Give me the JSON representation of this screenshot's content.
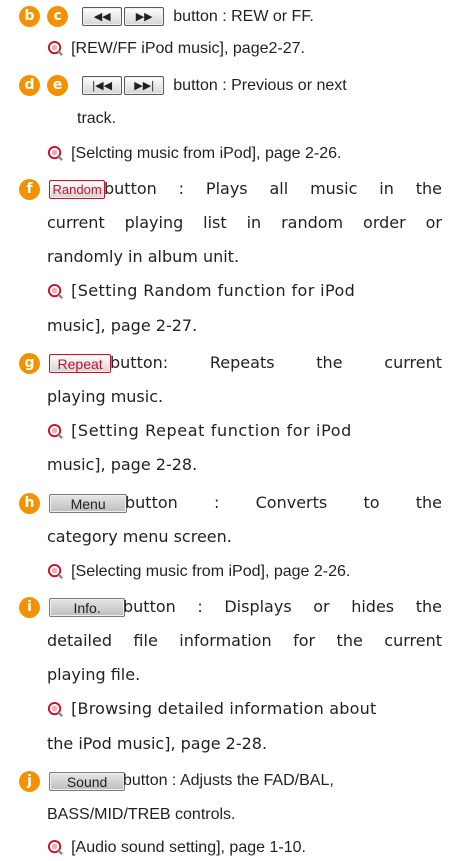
{
  "items": [
    {
      "letters": [
        "b",
        "c"
      ],
      "buttons": [
        "◀◀",
        "▶▶"
      ],
      "desc": "button : REW or FF.",
      "ref": "[REW/FF iPod music], page2-27."
    },
    {
      "letters": [
        "d",
        "e"
      ],
      "buttons": [
        "|◀◀",
        "▶▶|"
      ],
      "desc_line1": "button : Previous or next",
      "desc_line2": "track.",
      "ref": "[Selcting music from iPod], page 2-26."
    },
    {
      "letters": [
        "f"
      ],
      "button": "Random",
      "desc_line1": "button : Plays all music in the",
      "desc_line2": "current playing list in random order or",
      "desc_line3": "randomly in album unit.",
      "ref_line1": "[Setting Random function for iPod",
      "ref_line2": "music], page 2-27."
    },
    {
      "letters": [
        "g"
      ],
      "button": "Repeat",
      "desc_line1": "button: Repeats the current",
      "desc_line2": "playing music.",
      "ref_line1": "[Setting Repeat function for iPod",
      "ref_line2": "music], page 2-28."
    },
    {
      "letters": [
        "h"
      ],
      "button": "Menu",
      "desc_line1": "button : Converts to the",
      "desc_line2": "category menu screen.",
      "ref": "[Selecting music from iPod], page 2-26."
    },
    {
      "letters": [
        "i"
      ],
      "button": "Info.",
      "desc_line1": "button : Displays or hides the",
      "desc_line2": "detailed file information for the current",
      "desc_line3": "playing file.",
      "ref_line1": "[Browsing detailed information about",
      "ref_line2": "the iPod music], page 2-28."
    },
    {
      "letters": [
        "j"
      ],
      "button": "Sound",
      "desc_line1": "button : Adjusts the FAD/BAL,",
      "desc_line2": "BASS/MID/TREB controls.",
      "ref": "[Audio sound setting], page 1-10."
    }
  ],
  "colors": {
    "marker": "#f39200",
    "button_border_red": "#c8102e",
    "ref_icon": "#c8102e"
  },
  "icons": {
    "ref": "magnifier-reference-icon"
  }
}
